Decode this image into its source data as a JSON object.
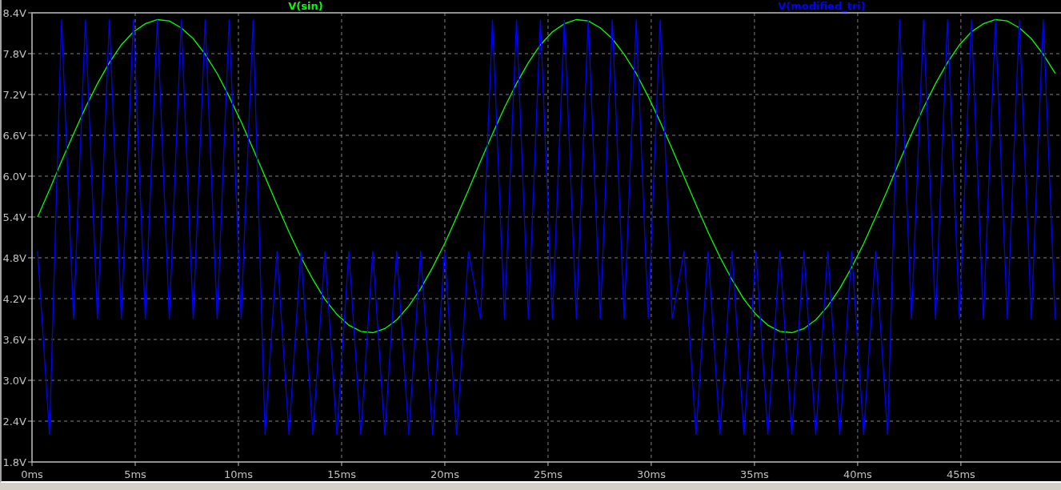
{
  "chart_data": {
    "type": "line",
    "grid": true,
    "xlim": [
      0,
      49.85
    ],
    "ylim": [
      1.8,
      8.4
    ],
    "xticks": [
      {
        "value": 0,
        "label": "0ms"
      },
      {
        "value": 5,
        "label": "5ms"
      },
      {
        "value": 10,
        "label": "10ms"
      },
      {
        "value": 15,
        "label": "15ms"
      },
      {
        "value": 20,
        "label": "20ms"
      },
      {
        "value": 25,
        "label": "25ms"
      },
      {
        "value": 30,
        "label": "30ms"
      },
      {
        "value": 35,
        "label": "35ms"
      },
      {
        "value": 40,
        "label": "40ms"
      },
      {
        "value": 45,
        "label": "45ms"
      }
    ],
    "yticks": [
      {
        "value": 1.8,
        "label": "1.8V"
      },
      {
        "value": 2.4,
        "label": "2.4V"
      },
      {
        "value": 3.0,
        "label": "3.0V"
      },
      {
        "value": 3.6,
        "label": "3.6V"
      },
      {
        "value": 4.2,
        "label": "4.2V"
      },
      {
        "value": 4.8,
        "label": "4.8V"
      },
      {
        "value": 5.4,
        "label": "5.4V"
      },
      {
        "value": 6.0,
        "label": "6.0V"
      },
      {
        "value": 6.6,
        "label": "6.6V"
      },
      {
        "value": 7.2,
        "label": "7.2V"
      },
      {
        "value": 7.8,
        "label": "7.8V"
      },
      {
        "value": 8.4,
        "label": "8.4V"
      }
    ],
    "x": [
      0.27,
      0.85,
      1.43,
      2.01,
      2.59,
      3.17,
      3.75,
      4.33,
      4.91,
      5.49,
      6.07,
      6.65,
      7.23,
      7.81,
      8.39,
      8.97,
      9.55,
      10.13,
      10.71,
      11.29,
      11.87,
      12.45,
      13.03,
      13.61,
      14.19,
      14.77,
      15.35,
      15.93,
      16.51,
      17.09,
      17.67,
      18.25,
      18.83,
      19.41,
      19.99,
      20.57,
      21.15,
      21.73,
      22.31,
      22.89,
      23.47,
      24.05,
      24.63,
      25.21,
      25.79,
      26.37,
      26.95,
      27.53,
      28.11,
      28.69,
      29.27,
      29.85,
      30.43,
      31.01,
      31.59,
      32.17,
      32.75,
      33.33,
      33.91,
      34.49,
      35.07,
      35.65,
      36.23,
      36.81,
      37.39,
      37.97,
      38.55,
      39.13,
      39.71,
      40.29,
      40.87,
      41.45,
      42.03,
      42.61,
      43.19,
      43.77,
      44.35,
      44.93,
      45.51,
      46.09,
      46.67,
      47.25,
      47.83,
      48.41,
      48.99,
      49.57
    ],
    "series": [
      {
        "name": "V(sin)",
        "color": "#00ff00",
        "values": [
          5.4,
          5.8,
          6.22,
          6.62,
          7.01,
          7.36,
          7.67,
          7.93,
          8.12,
          8.24,
          8.3,
          8.28,
          8.18,
          8.02,
          7.79,
          7.51,
          7.17,
          6.8,
          6.4,
          5.99,
          5.58,
          5.18,
          4.81,
          4.48,
          4.19,
          3.97,
          3.81,
          3.72,
          3.7,
          3.76,
          3.89,
          4.09,
          4.35,
          4.66,
          5.01,
          5.4,
          5.8,
          6.22,
          6.62,
          7.01,
          7.36,
          7.67,
          7.93,
          8.12,
          8.24,
          8.3,
          8.28,
          8.18,
          8.02,
          7.79,
          7.51,
          7.17,
          6.8,
          6.4,
          5.99,
          5.58,
          5.18,
          4.81,
          4.48,
          4.19,
          3.97,
          3.81,
          3.72,
          3.7,
          3.76,
          3.89,
          4.09,
          4.35,
          4.66,
          5.01,
          5.4,
          5.8,
          6.22,
          6.62,
          7.01,
          7.36,
          7.67,
          7.93,
          8.12,
          8.24,
          8.3,
          8.28,
          8.18,
          8.02,
          7.79,
          7.51
        ]
      },
      {
        "name": "V(modified_tri)",
        "color": "#0000ff",
        "values": [
          4.9,
          2.2,
          8.3,
          3.9,
          8.3,
          3.9,
          8.3,
          3.9,
          8.3,
          3.9,
          8.3,
          3.9,
          8.3,
          3.9,
          8.3,
          3.9,
          8.3,
          3.9,
          8.3,
          2.2,
          4.9,
          2.2,
          4.9,
          2.2,
          4.9,
          2.2,
          4.9,
          2.2,
          4.9,
          2.2,
          4.9,
          2.2,
          4.9,
          2.2,
          4.9,
          2.2,
          4.9,
          3.9,
          8.3,
          3.9,
          8.3,
          3.9,
          8.3,
          3.9,
          8.3,
          3.9,
          8.3,
          3.9,
          8.3,
          3.9,
          8.3,
          3.9,
          8.3,
          3.9,
          4.9,
          2.2,
          4.9,
          2.2,
          4.9,
          2.2,
          4.9,
          2.2,
          4.9,
          2.2,
          4.9,
          2.2,
          4.9,
          2.2,
          4.9,
          2.2,
          4.9,
          2.2,
          8.3,
          3.9,
          8.3,
          3.9,
          8.3,
          3.9,
          8.3,
          3.9,
          8.3,
          3.9,
          8.3,
          3.9,
          8.3,
          3.9
        ]
      }
    ]
  }
}
